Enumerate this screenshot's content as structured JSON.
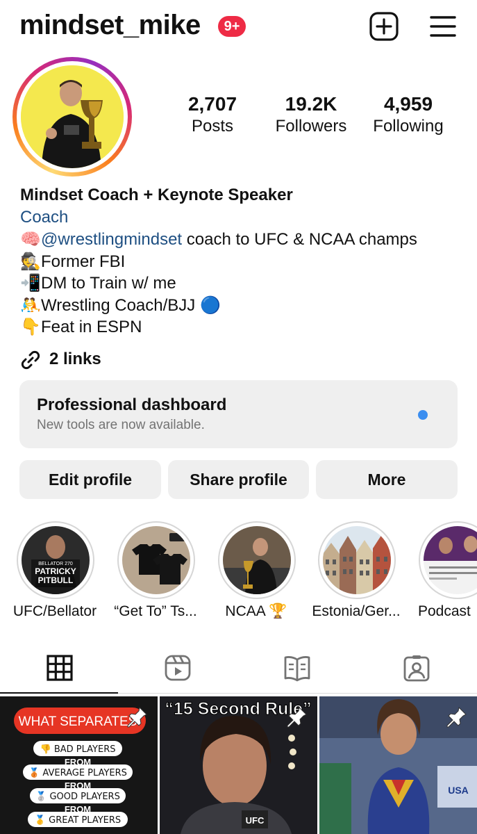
{
  "header": {
    "username": "mindset_mike",
    "notification_badge": "9+",
    "icons": [
      "new-post-icon",
      "hamburger-menu-icon"
    ]
  },
  "profile": {
    "stats": [
      {
        "value": "2,707",
        "label": "Posts"
      },
      {
        "value": "19.2K",
        "label": "Followers"
      },
      {
        "value": "4,959",
        "label": "Following"
      }
    ]
  },
  "bio": {
    "name": "Mindset Coach + Keynote Speaker",
    "category": "Coach",
    "lines": [
      {
        "emoji": "🧠",
        "mention": "@wrestlingmindset",
        "text": " coach to UFC & NCAA champs"
      },
      {
        "emoji": "🕵",
        "text": "Former FBI"
      },
      {
        "emoji": "📲",
        "text": "DM to Train w/ me"
      },
      {
        "emoji": "🤼",
        "text": "Wrestling Coach/BJJ ",
        "trailing_emoji": "🔵"
      },
      {
        "emoji": "👇",
        "text": "Feat in ESPN"
      }
    ],
    "links": "2 links"
  },
  "dashboard": {
    "title": "Professional dashboard",
    "subtitle": "New tools are now available."
  },
  "buttons": {
    "edit": "Edit profile",
    "share": "Share profile",
    "more": "More"
  },
  "highlights": [
    {
      "label": "UFC/Bellator",
      "img_text_1": "BELLATOR 270",
      "img_text_2": "PATRICKY",
      "img_text_3": "PITBULL"
    },
    {
      "label": "“Get To” Ts..."
    },
    {
      "label": "NCAA 🏆"
    },
    {
      "label": "Estonia/Ger..."
    },
    {
      "label": "Podcast"
    }
  ],
  "tabs": [
    "grid-icon",
    "reels-icon",
    "guides-icon",
    "tagged-icon"
  ],
  "posts": [
    {
      "headline": "WHAT SEPARATES",
      "rows": [
        "👎 BAD PLAYERS",
        "FROM",
        "🥉 AVERAGE PLAYERS",
        "FROM",
        "🥈 GOOD PLAYERS",
        "FROM",
        "🥇 GREAT PLAYERS"
      ]
    },
    {
      "headline": "“15 Second Rule”",
      "logo": "UFC"
    },
    {
      "headline": "",
      "banner": "USA"
    }
  ],
  "colors": {
    "badge": "#ee2b45",
    "link": "#1e4f82",
    "dot": "#3b8ef0",
    "button_bg": "#efefef"
  }
}
